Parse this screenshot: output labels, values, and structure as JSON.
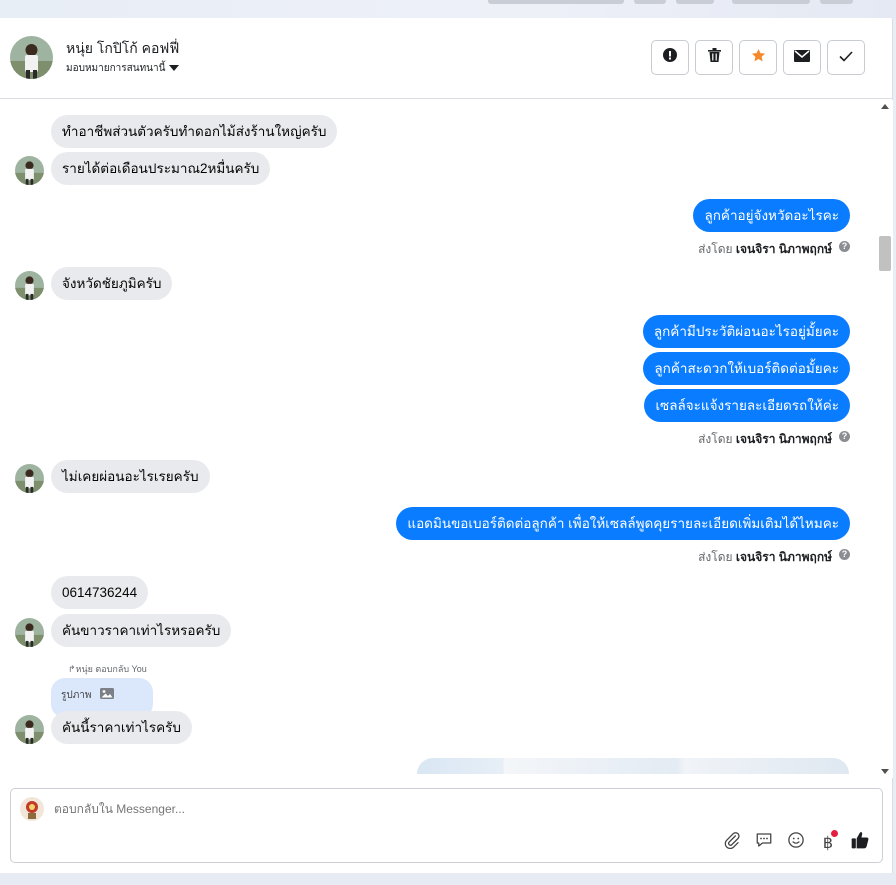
{
  "header": {
    "name": "หนุ่ย โกปิโก้ คอฟฟี่",
    "assign_label": "มอบหมายการสนทนานี้",
    "actions": [
      {
        "name": "spam-button",
        "icon": "alert-icon"
      },
      {
        "name": "delete-button",
        "icon": "trash-icon"
      },
      {
        "name": "star-button",
        "icon": "star-icon"
      },
      {
        "name": "unread-button",
        "icon": "envelope-icon"
      },
      {
        "name": "done-button",
        "icon": "check-icon"
      }
    ]
  },
  "messages": {
    "in1": "ทำอาชีพส่วนตัวครับทำดอกไม้ส่งร้านใหญ่ครับ",
    "in2": "รายได้ต่อเดือนประมาณ2หมื่นครับ",
    "out1": "ลูกค้าอยู่จังหวัดอะไรคะ",
    "sent_prefix": "ส่งโดย",
    "sender": "เจนจิรา นิภาพฤกษ์",
    "in3": "จังหวัดชัยภูมิครับ",
    "out2": "ลูกค้ามีประวัติผ่อนอะไรอยู่มั้ยคะ",
    "out3": "ลูกค้าสะดวกให้เบอร์ติดต่อมั้ยคะ",
    "out4": "เซลล์จะแจ้งรายละเอียดรถให้ค่ะ",
    "in4": "ไม่เคยผ่อนอะไรเรยครับ",
    "out5": "แอดมินขอเบอร์ติดต่อลูกค้า เพื่อให้เซลล์พูดคุยรายละเอียดเพิ่มเติมได้ไหมคะ",
    "in5": "0614736244",
    "in6": "คันขาวราคาเท่าไรหรอครับ",
    "reply_note": "หนุ่ย ตอบกลับ You",
    "reply_quote": "รูปภาพ",
    "in7": "คันนี้ราคาเท่าไรครับ"
  },
  "composer": {
    "placeholder": "ตอบกลับใน Messenger...",
    "tools": [
      "paperclip-icon",
      "saved-reply-icon",
      "emoji-icon",
      "baht-icon",
      "thumbs-up-icon"
    ],
    "baht_glyph": "฿"
  },
  "colors": {
    "outgoing": "#0a7cff",
    "incoming": "#e9eaed",
    "star": "#f5892a",
    "notification_dot": "#e41e3f"
  }
}
